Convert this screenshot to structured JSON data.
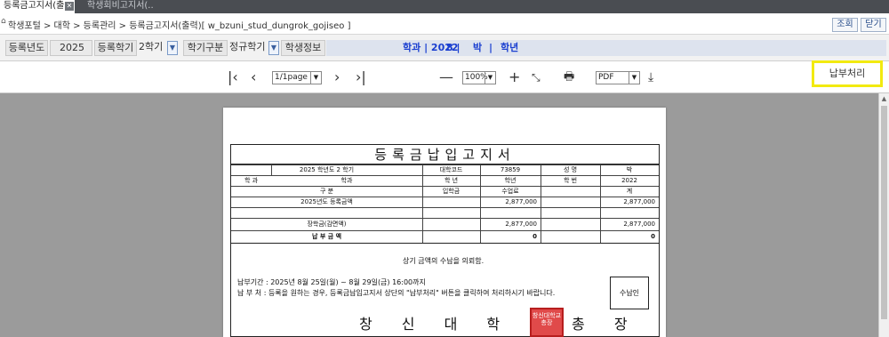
{
  "tabs": [
    {
      "label": "등록금고지서(출..",
      "active": true
    },
    {
      "label": "학생회비고지서(..",
      "active": false
    }
  ],
  "breadcrumb": "학생포털 > 대학 > 등록관리 > 등록금고지서(출력)[ w_bzuni_stud_dungrok_gojiseo ]",
  "buttons": {
    "query": "조회",
    "close": "닫기"
  },
  "filters": {
    "year_label": "등록년도",
    "year_value": "2025",
    "term_label": "등록학기",
    "term_value": "2학기",
    "kind_label": "학기구분",
    "kind_value": "정규학기",
    "student_label": "학생정보",
    "student_dept": "학과 | 2022",
    "student_no": "8 |",
    "student_name": "박",
    "student_sep": "|",
    "student_grade": "학년"
  },
  "toolbar": {
    "page": "1/1page",
    "zoom": "100%",
    "format": "PDF",
    "icons": [
      "first-page-icon",
      "prev-page-icon",
      "next-page-icon",
      "last-page-icon",
      "zoom-out-icon",
      "zoom-in-icon",
      "fit-page-icon",
      "print-icon",
      "download-icon"
    ]
  },
  "pay_button": "납부처리",
  "document": {
    "title": "등록금납입고지서",
    "rows": {
      "r1": [
        "2025 학년도  2 학기",
        "대학코드",
        "73859",
        "성          명",
        "박"
      ],
      "r2": [
        "학          과",
        "학과",
        "학          년",
        "학년",
        "학          번",
        "2022"
      ],
      "header": [
        "구          분",
        "입학금",
        "수업료",
        "계"
      ],
      "fee_label": "2025년도 등록금액",
      "fee_tuition": "2,877,000",
      "fee_total": "2,877,000",
      "scholar_label": "장학금(감면액)",
      "scholar_tuition": "2,877,000",
      "scholar_total": "2,877,000",
      "payable_label": "납 부 금 액",
      "payable_tuition": "0",
      "payable_total": "0"
    },
    "request": "상기 금액의 수납을 의뢰함.",
    "period": "납부기간 :  2025년  8월  25일(월) ~ 8월  29일(금)  16:00까지",
    "place": "납  부  처 :  등록을 원하는 경우, 등록금납입고지서 상단의 \"납부처리\" 버튼을 클릭하여 처리하시기 바랍니다.",
    "receipt": "수납인",
    "university": "창 신 대 학 교 총 장",
    "seal_text": "창신대학교총장"
  },
  "colors": {
    "accent_yellow": "#f2ea10",
    "student_info_text": "#1a3fd0",
    "seal": "#e04a4a"
  }
}
